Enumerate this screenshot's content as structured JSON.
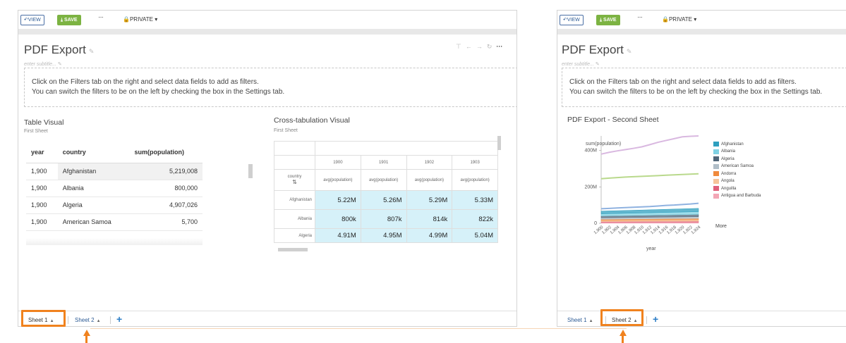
{
  "toolbar": {
    "view_label": "↶VIEW",
    "save_label": "⤓ SAVE",
    "more_label": "···",
    "private_label": "🔒PRIVATE ▾"
  },
  "dashboard": {
    "title": "PDF Export",
    "subtitle_placeholder": "enter subtitle...",
    "filter_hint_line1": "Click on the Filters tab on the right and select data fields to add as filters.",
    "filter_hint_line2": "You can switch the filters to be on the left by checking the box in the Settings tab."
  },
  "table_visual": {
    "title": "Table Visual",
    "sheet": "First Sheet",
    "columns": [
      "year",
      "country",
      "sum(population)"
    ],
    "rows": [
      [
        "1,900",
        "Afghanistan",
        "5,219,008"
      ],
      [
        "1,900",
        "Albania",
        "800,000"
      ],
      [
        "1,900",
        "Algeria",
        "4,907,026"
      ],
      [
        "1,900",
        "American Samoa",
        "5,700"
      ]
    ]
  },
  "crosstab_visual": {
    "title": "Cross-tabulation Visual",
    "sheet": "First Sheet",
    "years": [
      "1900",
      "1901",
      "1902",
      "1903"
    ],
    "measure": "avg(population)",
    "row_header": "country",
    "rows": [
      {
        "country": "Afghanistan",
        "values": [
          "5.22M",
          "5.26M",
          "5.29M",
          "5.33M"
        ]
      },
      {
        "country": "Albania",
        "values": [
          "800k",
          "807k",
          "814k",
          "822k"
        ]
      },
      {
        "country": "Algeria",
        "values": [
          "4.91M",
          "4.95M",
          "4.99M",
          "5.04M"
        ]
      }
    ]
  },
  "second_sheet": {
    "title": "PDF Export - Second Sheet",
    "legend_more": "More"
  },
  "chart_data": {
    "type": "area",
    "title": "PDF Export - Second Sheet",
    "ylabel": "sum(population)",
    "xlabel": "year",
    "x": [
      "1,900",
      "1,902",
      "1,904",
      "1,906",
      "1,908",
      "1,910",
      "1,912",
      "1,914",
      "1,916",
      "1,918",
      "1,920",
      "1,922",
      "1,924"
    ],
    "yticks": [
      "0",
      "200M",
      "400M"
    ],
    "ylim": [
      0,
      480000000
    ],
    "series": [
      {
        "name": "Afghanistan",
        "color": "#2e9fbe",
        "values": [
          15000000,
          15200000,
          15400000,
          15600000,
          15900000,
          16100000,
          16400000,
          16700000,
          17000000,
          17300000,
          17600000,
          17900000,
          18200000
        ]
      },
      {
        "name": "Albania",
        "color": "#7fd1e3",
        "values": [
          12000000,
          12200000,
          12400000,
          12700000,
          13000000,
          13200000,
          13500000,
          13800000,
          14100000,
          14400000,
          14700000,
          15000000,
          15300000
        ]
      },
      {
        "name": "Algeria",
        "color": "#4f6578",
        "values": [
          10000000,
          10200000,
          10400000,
          10600000,
          10800000,
          11000000,
          11200000,
          11400000,
          11600000,
          11800000,
          12000000,
          12200000,
          12400000
        ]
      },
      {
        "name": "American Samoa",
        "color": "#b0bec8",
        "values": [
          8000000,
          8100000,
          8200000,
          8300000,
          8400000,
          8500000,
          8600000,
          8700000,
          8800000,
          8900000,
          9000000,
          9100000,
          9200000
        ]
      },
      {
        "name": "Andorra",
        "color": "#f08a3c",
        "values": [
          7000000,
          7100000,
          7200000,
          7300000,
          7400000,
          7500000,
          7600000,
          7700000,
          7800000,
          7900000,
          8000000,
          8100000,
          8200000
        ]
      },
      {
        "name": "Angola",
        "color": "#f6c49a",
        "values": [
          6000000,
          6100000,
          6200000,
          6300000,
          6400000,
          6500000,
          6600000,
          6700000,
          6800000,
          6900000,
          7000000,
          7100000,
          7200000
        ]
      },
      {
        "name": "Anguilla",
        "color": "#e0607a",
        "values": [
          5000000,
          5100000,
          5200000,
          5300000,
          5400000,
          5500000,
          5600000,
          5700000,
          5800000,
          5900000,
          6000000,
          6100000,
          6200000
        ]
      },
      {
        "name": "Antigua and Barbuda",
        "color": "#f3a6b5",
        "values": [
          4000000,
          4100000,
          4200000,
          4300000,
          4400000,
          4500000,
          4600000,
          4700000,
          4800000,
          4900000,
          5000000,
          5100000,
          5200000
        ]
      }
    ],
    "extra_lines": [
      {
        "color": "#d9b8e0",
        "values": [
          380000000,
          390000000,
          398000000,
          405000000,
          412000000,
          420000000,
          432000000,
          445000000,
          455000000,
          465000000,
          475000000,
          478000000,
          480000000
        ]
      },
      {
        "color": "#b9d98c",
        "values": [
          245000000,
          248000000,
          251000000,
          254000000,
          256000000,
          258000000,
          260000000,
          262000000,
          264000000,
          266000000,
          268000000,
          270000000,
          272000000
        ]
      },
      {
        "color": "#8fb2e0",
        "values": [
          80000000,
          82000000,
          84000000,
          86000000,
          88000000,
          90000000,
          92000000,
          95000000,
          98000000,
          100000000,
          103000000,
          106000000,
          110000000
        ]
      }
    ],
    "legend_position": "right"
  },
  "sheets": {
    "tab1": "Sheet 1",
    "tab2": "Sheet 2",
    "add": "+"
  }
}
